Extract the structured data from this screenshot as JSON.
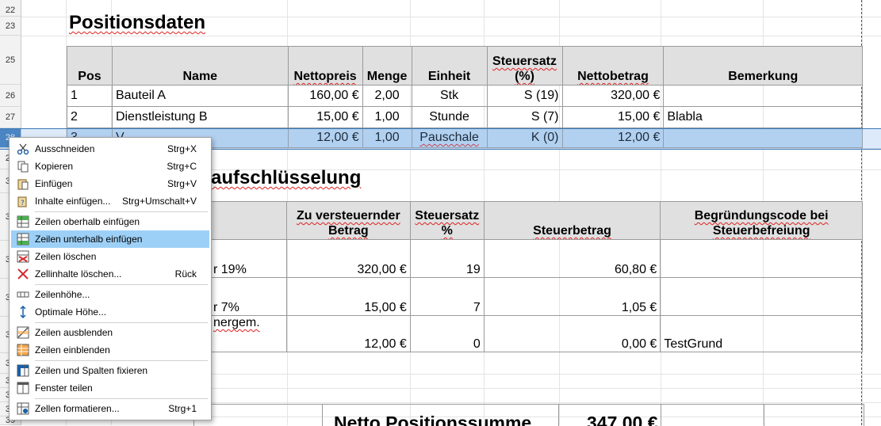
{
  "row_numbers": [
    "22",
    "23",
    "25",
    "26",
    "27",
    "28",
    "29",
    "30",
    "31",
    "32",
    "33",
    "34",
    "35",
    "36",
    "37",
    "38",
    "39"
  ],
  "section1_title": "Positionsdaten",
  "section2_title_partial": "aufschlüsselung",
  "positions": {
    "headers": [
      "Pos",
      "Name",
      "Nettopreis",
      "Menge",
      "Einheit",
      "Steuersatz (%)",
      "Nettobetrag",
      "Bemerkung"
    ],
    "rows": [
      [
        "1",
        "Bauteil A",
        "160,00 €",
        "2,00",
        "Stk",
        "S (19)",
        "320,00 €",
        ""
      ],
      [
        "2",
        "Dienstleistung B",
        "15,00 €",
        "1,00",
        "Stunde",
        "S (7)",
        "15,00 €",
        "Blabla"
      ],
      [
        "3",
        "V…",
        "12,00 €",
        "1,00",
        "Pauschale",
        "K (0)",
        "12,00 €",
        ""
      ]
    ]
  },
  "tax": {
    "headers": [
      "",
      "Zu versteuernder Betrag",
      "Steuersatz %",
      "Steuerbetrag",
      "Begründungscode bei Steuerbefreiung"
    ],
    "rows": [
      [
        "r 19%",
        "320,00 €",
        "19",
        "60,80 €",
        ""
      ],
      [
        "r 7%",
        "15,00 €",
        "7",
        "1,05 €",
        ""
      ],
      [
        "nergem.",
        "12,00 €",
        "0",
        "0,00 €",
        "TestGrund"
      ]
    ]
  },
  "bottom": {
    "label": "Netto Positionssumme",
    "value": "347,00 €"
  },
  "context_menu": [
    {
      "icon": "scissors-icon",
      "label": "Ausschneiden",
      "shortcut": "Strg+X"
    },
    {
      "icon": "copy-icon",
      "label": "Kopieren",
      "shortcut": "Strg+C"
    },
    {
      "icon": "paste-icon",
      "label": "Einfügen",
      "shortcut": "Strg+V"
    },
    {
      "icon": "paste-special-icon",
      "label": "Inhalte einfügen...",
      "shortcut": "Strg+Umschalt+V"
    },
    {
      "icon": "insert-rows-above-icon",
      "label": "Zeilen oberhalb einfügen",
      "shortcut": ""
    },
    {
      "icon": "insert-rows-below-icon",
      "label": "Zeilen unterhalb einfügen",
      "shortcut": "",
      "highlighted": true
    },
    {
      "icon": "delete-rows-icon",
      "label": "Zeilen löschen",
      "shortcut": ""
    },
    {
      "icon": "delete-contents-icon",
      "label": "Zellinhalte löschen...",
      "shortcut": "Rück"
    },
    {
      "icon": "row-height-icon",
      "label": "Zeilenhöhe...",
      "shortcut": ""
    },
    {
      "icon": "optimal-height-icon",
      "label": "Optimale Höhe...",
      "shortcut": ""
    },
    {
      "icon": "hide-rows-icon",
      "label": "Zeilen ausblenden",
      "shortcut": ""
    },
    {
      "icon": "show-rows-icon",
      "label": "Zeilen einblenden",
      "shortcut": ""
    },
    {
      "icon": "freeze-icon",
      "label": "Zeilen und Spalten fixieren",
      "shortcut": ""
    },
    {
      "icon": "split-window-icon",
      "label": "Fenster teilen",
      "shortcut": ""
    },
    {
      "icon": "format-cells-icon",
      "label": "Zellen formatieren...",
      "shortcut": "Strg+1"
    }
  ]
}
